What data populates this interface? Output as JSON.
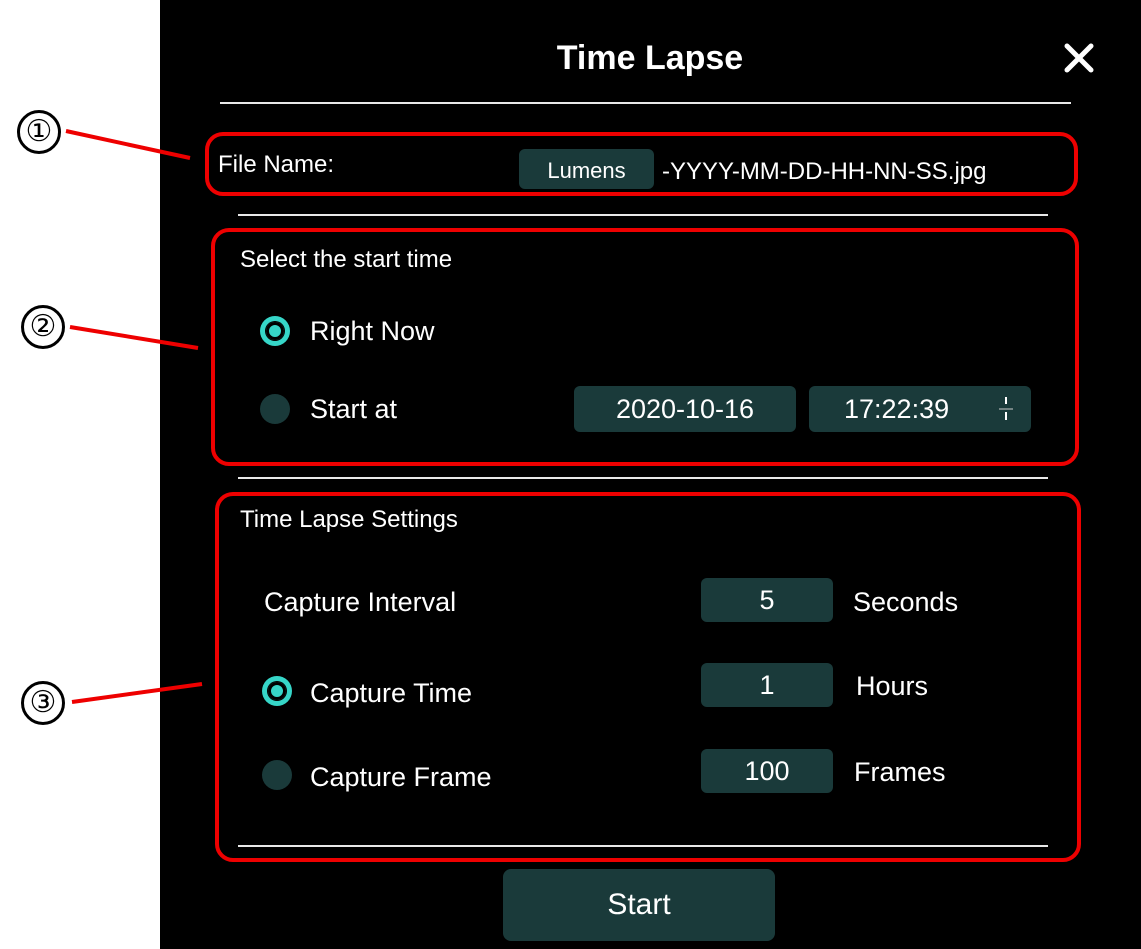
{
  "dialog": {
    "title": "Time Lapse"
  },
  "file_name": {
    "label": "File Name:",
    "prefix_value": "Lumens",
    "suffix": "-YYYY-MM-DD-HH-NN-SS.jpg"
  },
  "start_time": {
    "heading": "Select the start time",
    "right_now_label": "Right Now",
    "start_at_label": "Start at",
    "date_value": "2020-10-16",
    "time_value": "17:22:39",
    "selected": "Right Now"
  },
  "settings": {
    "heading": "Time Lapse Settings",
    "interval_label": "Capture Interval",
    "interval_value": "5",
    "interval_unit": "Seconds",
    "capture_time_label": "Capture Time",
    "capture_time_value": "1",
    "capture_time_unit": "Hours",
    "capture_frame_label": "Capture Frame",
    "capture_frame_value": "100",
    "capture_frame_unit": "Frames",
    "selected": "Capture Time"
  },
  "actions": {
    "start_label": "Start"
  },
  "callouts": [
    "①",
    "②",
    "③"
  ],
  "colors": {
    "background": "#000000",
    "field": "#1a3a3a",
    "accent": "#36d6c8",
    "highlight": "#ee0000"
  }
}
